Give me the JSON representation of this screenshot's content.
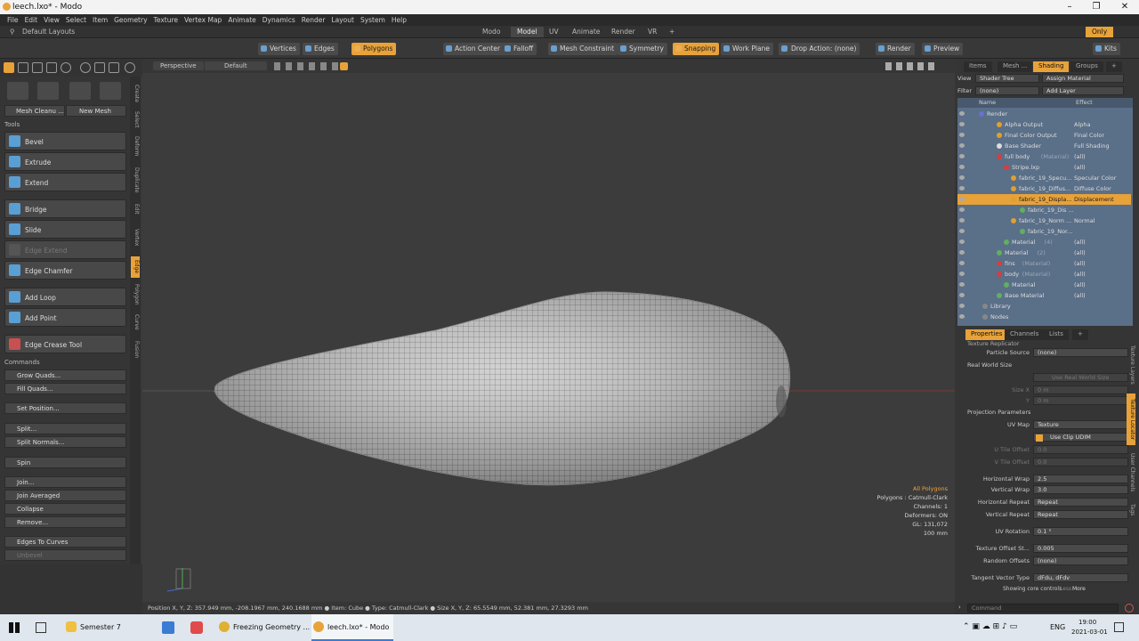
{
  "window": {
    "title": "leech.lxo* - Modo"
  },
  "menu": [
    "File",
    "Edit",
    "View",
    "Select",
    "Item",
    "Geometry",
    "Texture",
    "Vertex Map",
    "Animate",
    "Dynamics",
    "Render",
    "Layout",
    "System",
    "Help"
  ],
  "layout": {
    "default": "Default Layouts",
    "tabs": [
      "Modo",
      "Model",
      "UV",
      "Animate",
      "Render",
      "VR",
      "+"
    ],
    "active": "Model",
    "only": "Only"
  },
  "toolbar": {
    "vertices": "Vertices",
    "edges": "Edges",
    "polygons": "Polygons",
    "action_center": "Action Center",
    "falloff": "Falloff",
    "mesh_constraint": "Mesh Constraint",
    "symmetry": "Symmetry",
    "snapping": "Snapping",
    "work_plane": "Work Plane",
    "drop_action": "Drop Action: (none)",
    "render": "Render",
    "preview": "Preview",
    "kits": "Kits"
  },
  "leftpanel": {
    "mesh_cleanup": "Mesh Cleanu ...",
    "new_mesh": "New Mesh",
    "tools_header": "Tools",
    "tools": [
      "Bevel",
      "Extrude",
      "Extend",
      "Bridge",
      "Slide",
      "Edge Extend",
      "Edge Chamfer",
      "Add Loop",
      "Add Point",
      "Edge Crease Tool"
    ],
    "commands_header": "Commands",
    "commands": [
      "Grow Quads...",
      "Fill Quads...",
      "Set Position...",
      "Split...",
      "Split Normals...",
      "Spin",
      "Join...",
      "Join Averaged",
      "Collapse",
      "Remove...",
      "Edges To Curves",
      "Unbevel"
    ],
    "vtabs": [
      "Create",
      "Select",
      "Deform",
      "Duplicate",
      "Edit",
      "Vertex",
      "Edge",
      "Polygon",
      "Curve",
      "Fusion"
    ]
  },
  "viewport": {
    "view": "Perspective",
    "shading": "Default",
    "stats": {
      "title": "All Polygons",
      "polygons": "Polygons : Catmull-Clark",
      "channels": "Channels: 1",
      "deformers": "Deformers: ON",
      "gl": "GL: 131,072",
      "size": "100 mm"
    }
  },
  "statusline": "Position X, Y, Z:  357.949 mm, -208.1967 mm, 240.1688 mm ● Item:  Cube ● Type:  Catmull-Clark ● Size X, Y, Z:   65.5549 mm, 52.381 mm, 27.3293 mm",
  "rightpanel": {
    "tabs": [
      "Items",
      "Mesh ...",
      "Shading",
      "Groups",
      "+"
    ],
    "view_label": "View",
    "view_value": "Shader Tree",
    "assign": "Assign Material",
    "filter_label": "Filter",
    "filter_value": "(none)",
    "add_layer": "Add Layer",
    "col_name": "Name",
    "col_effect": "Effect",
    "tree": [
      {
        "name": "Render",
        "effect": "",
        "indent": 24,
        "dot": "#6a70d0"
      },
      {
        "name": "Alpha Output",
        "effect": "Alpha",
        "indent": 44,
        "dot": "#e0a030"
      },
      {
        "name": "Final Color Output",
        "effect": "Final Color",
        "indent": 44,
        "dot": "#e0a030"
      },
      {
        "name": "Base Shader",
        "effect": "Full Shading",
        "indent": 44,
        "dot": "#dddddd"
      },
      {
        "name": "full body",
        "tag": "(Material)",
        "effect": "(all)",
        "indent": 44,
        "dot": "#d04040"
      },
      {
        "name": "Stripe.lxp",
        "effect": "(all)",
        "indent": 52,
        "dot": "#d04040"
      },
      {
        "name": "fabric_19_Specu...",
        "effect": "Specular Color",
        "indent": 60,
        "dot": "#e0a030"
      },
      {
        "name": "fabric_19_Diffus...",
        "effect": "Diffuse Color",
        "indent": 60,
        "dot": "#e0a030"
      },
      {
        "name": "fabric_19_Displa...",
        "effect": "Displacement",
        "indent": 60,
        "dot": "#e0a030",
        "selected": true
      },
      {
        "name": "fabric_19_Dis ...",
        "effect": "",
        "indent": 70,
        "dot": "#60b060"
      },
      {
        "name": "fabric_19_Norm ...",
        "effect": "Normal",
        "indent": 60,
        "dot": "#e0a030"
      },
      {
        "name": "fabric_19_Nor...",
        "effect": "",
        "indent": 70,
        "dot": "#60b060"
      },
      {
        "name": "Material",
        "tag": "(4)",
        "effect": "(all)",
        "indent": 52,
        "dot": "#60b060"
      },
      {
        "name": "Material",
        "tag": "(2)",
        "effect": "(all)",
        "indent": 44,
        "dot": "#60b060"
      },
      {
        "name": "fins",
        "tag": "(Material)",
        "effect": "(all)",
        "indent": 44,
        "dot": "#d04040"
      },
      {
        "name": "body",
        "tag": "(Material)",
        "effect": "(all)",
        "indent": 44,
        "dot": "#d04040"
      },
      {
        "name": "Material",
        "effect": "(all)",
        "indent": 52,
        "dot": "#60b060"
      },
      {
        "name": "Base Material",
        "effect": "(all)",
        "indent": 44,
        "dot": "#60b060"
      },
      {
        "name": "Library",
        "effect": "",
        "indent": 28,
        "dot": "#888888"
      },
      {
        "name": "Nodes",
        "effect": "",
        "indent": 28,
        "dot": "#888888"
      }
    ],
    "ptabs": [
      "Properties",
      "Channels",
      "Lists",
      "+"
    ],
    "props": {
      "replicator": "Texture Replicator",
      "particle_source": {
        "label": "Particle Source",
        "value": "(none)"
      },
      "real_world": "Real World Size",
      "use_rws": "Use Real World Size",
      "size_x": {
        "label": "Size X",
        "value": "0 m"
      },
      "size_y": {
        "label": "Y",
        "value": "0 m"
      },
      "projection": "Projection Parameters",
      "uv_map": {
        "label": "UV Map",
        "value": "Texture"
      },
      "use_clip": "Use Clip UDIM",
      "u_tile": {
        "label": "U Tile Offset",
        "value": "0.0"
      },
      "v_tile": {
        "label": "V Tile Offset",
        "value": "0.0"
      },
      "hwrap": {
        "label": "Horizontal Wrap",
        "value": "2.5"
      },
      "vwrap": {
        "label": "Vertical Wrap",
        "value": "3.0"
      },
      "hrep": {
        "label": "Horizontal Repeat",
        "value": "Repeat"
      },
      "vrep": {
        "label": "Vertical Repeat",
        "value": "Repeat"
      },
      "uvrot": {
        "label": "UV Rotation",
        "value": "0.1 °"
      },
      "texoff": {
        "label": "Texture Offset St...",
        "value": "0.005"
      },
      "randoff": {
        "label": "Random Offsets",
        "value": "(none)"
      },
      "tangent": {
        "label": "Tangent Vector Type",
        "value": "dFdu, dFdv"
      },
      "showing": "Showing core controls",
      "less": "Less",
      "more": "More"
    },
    "pvtabs": [
      "Texture Layers",
      "Texture Locator",
      "User Channels",
      "Tags"
    ],
    "command_placeholder": "Command"
  },
  "taskbar": {
    "items": [
      "Semester 7",
      "Freezing Geometry ...",
      "leech.lxo* - Modo"
    ],
    "lang": "ENG",
    "time": "19:00",
    "date": "2021-03-01"
  }
}
